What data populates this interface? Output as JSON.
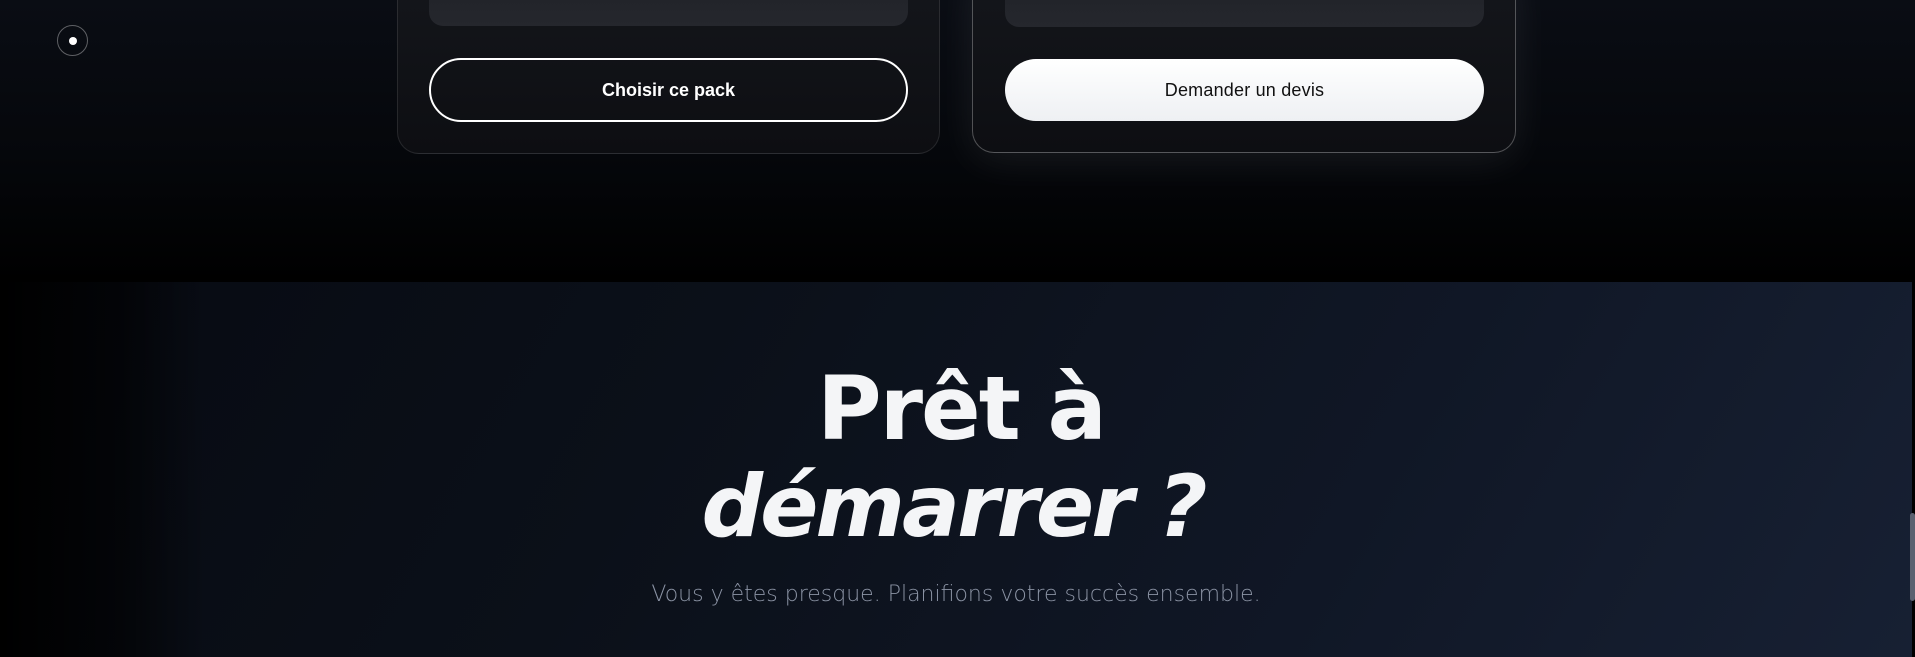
{
  "pricing": {
    "left_card": {
      "button_label": "Choisir ce pack"
    },
    "right_card": {
      "button_label": "Demander un devis"
    }
  },
  "cta": {
    "title_line1": "Prêt à",
    "title_line2": "démarrer ?",
    "subtitle": "Vous y êtes presque. Planifions votre succès ensemble."
  },
  "icons": {
    "cursor": "cursor-dot-icon"
  },
  "colors": {
    "background": "#000000",
    "cta_background": "#0b1019",
    "text_primary": "#f4f5f7",
    "text_muted": "#8b93a4",
    "button_solid": "#ffffff"
  }
}
